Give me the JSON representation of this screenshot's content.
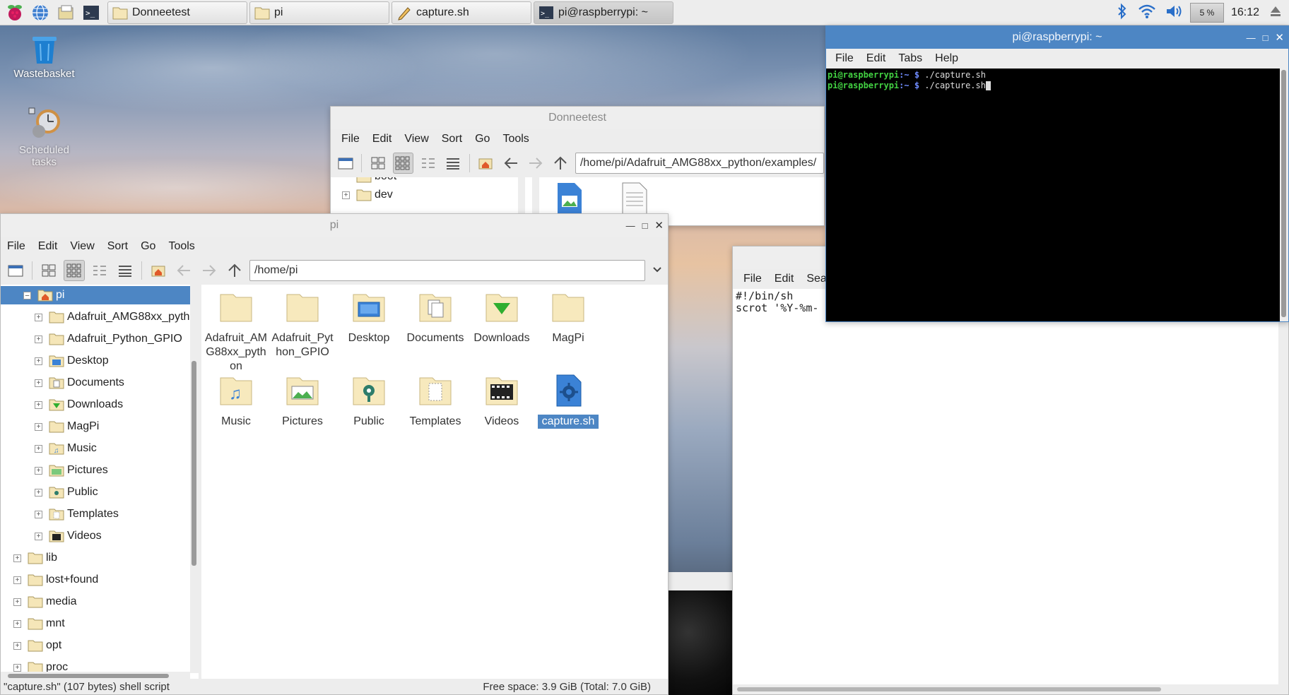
{
  "taskbar": {
    "buttons": [
      {
        "label": "Donneetest"
      },
      {
        "label": "pi"
      },
      {
        "label": "capture.sh"
      },
      {
        "label": "pi@raspberrypi: ~"
      }
    ],
    "cpu": "5 %",
    "clock": "16:12"
  },
  "desktop": {
    "wastebasket": "Wastebasket",
    "scheduled": "Scheduled tasks"
  },
  "donneetest": {
    "title": "Donneetest",
    "menu": [
      "File",
      "Edit",
      "View",
      "Sort",
      "Go",
      "Tools"
    ],
    "address": "/home/pi/Adafruit_AMG88xx_python/examples/",
    "tree": [
      "boot",
      "dev"
    ]
  },
  "pi_window": {
    "title": "pi",
    "menu": [
      "File",
      "Edit",
      "View",
      "Sort",
      "Go",
      "Tools"
    ],
    "address": "/home/pi",
    "tree": [
      "pi",
      "Adafruit_AMG88xx_python",
      "Adafruit_Python_GPIO",
      "Desktop",
      "Documents",
      "Downloads",
      "MagPi",
      "Music",
      "Pictures",
      "Public",
      "Templates",
      "Videos",
      "lib",
      "lost+found",
      "media",
      "mnt",
      "opt",
      "proc"
    ],
    "icons": [
      "Adafruit_AMG88xx_python",
      "Adafruit_Python_GPIO",
      "Desktop",
      "Documents",
      "Downloads",
      "MagPi",
      "Music",
      "Pictures",
      "Public",
      "Templates",
      "Videos",
      "capture.sh"
    ],
    "status_left": "\"capture.sh\" (107 bytes) shell script",
    "status_right": "Free space: 3.9 GiB (Total: 7.0 GiB)"
  },
  "editor": {
    "menu": [
      "File",
      "Edit",
      "Search"
    ],
    "line1": "#!/bin/sh",
    "line2": "scrot '%Y-%m-"
  },
  "terminal": {
    "title": "pi@raspberrypi: ~",
    "menu": [
      "File",
      "Edit",
      "Tabs",
      "Help"
    ],
    "user": "pi@raspberrypi",
    "path": ":~ $ ",
    "cmd1": "./capture.sh",
    "cmd2": "./capture.sh"
  },
  "colors": {
    "selection": "#4d86c4",
    "prompt_user": "#42d042",
    "prompt_path": "#6f8cff"
  }
}
